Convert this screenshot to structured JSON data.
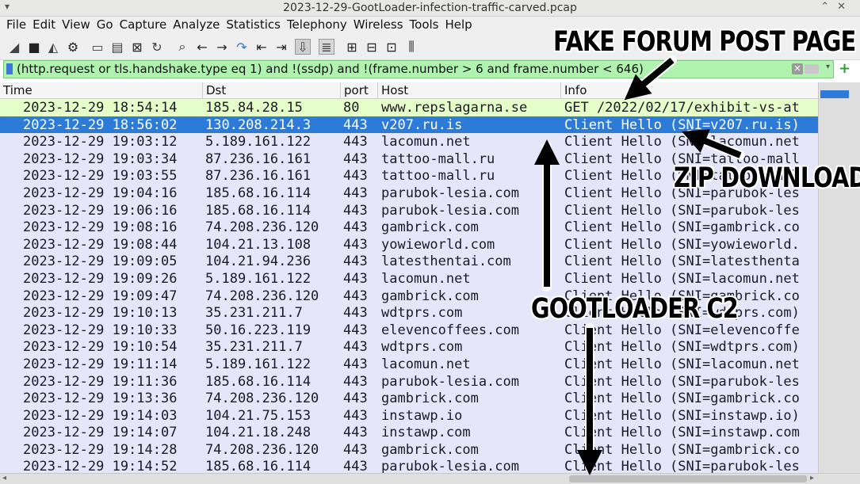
{
  "window": {
    "title": "2023-12-29-GootLoader-infection-traffic-carved.pcap"
  },
  "menu": [
    "File",
    "Edit",
    "View",
    "Go",
    "Capture",
    "Analyze",
    "Statistics",
    "Telephony",
    "Wireless",
    "Tools",
    "Help"
  ],
  "filter": {
    "text": "(http.request or tls.handshake.type eq 1) and !(ssdp) and !(frame.number > 6 and frame.number < 646)"
  },
  "columns": {
    "time": "Time",
    "dst": "Dst",
    "port": "port",
    "host": "Host",
    "info": "Info"
  },
  "rows": [
    {
      "time": "2023-12-29 18:54:14",
      "dst": "185.84.28.15",
      "port": "80",
      "host": "www.repslagarna.se",
      "info": "GET /2022/02/17/exhibit-vs-at"
    },
    {
      "time": "2023-12-29 18:56:02",
      "dst": "130.208.214.3",
      "port": "443",
      "host": "v207.ru.is",
      "info": "Client Hello (SNI=v207.ru.is)"
    },
    {
      "time": "2023-12-29 19:03:12",
      "dst": "5.189.161.122",
      "port": "443",
      "host": "lacomun.net",
      "info": "Client Hello (SNI=lacomun.net"
    },
    {
      "time": "2023-12-29 19:03:34",
      "dst": "87.236.16.161",
      "port": "443",
      "host": "tattoo-mall.ru",
      "info": "Client Hello (SNI=tattoo-mall"
    },
    {
      "time": "2023-12-29 19:03:55",
      "dst": "87.236.16.161",
      "port": "443",
      "host": "tattoo-mall.ru",
      "info": "Client Hello (SNI=tattoo-mall"
    },
    {
      "time": "2023-12-29 19:04:16",
      "dst": "185.68.16.114",
      "port": "443",
      "host": "parubok-lesia.com",
      "info": "Client Hello (SNI=parubok-les"
    },
    {
      "time": "2023-12-29 19:06:16",
      "dst": "185.68.16.114",
      "port": "443",
      "host": "parubok-lesia.com",
      "info": "Client Hello (SNI=parubok-les"
    },
    {
      "time": "2023-12-29 19:08:16",
      "dst": "74.208.236.120",
      "port": "443",
      "host": "gambrick.com",
      "info": "Client Hello (SNI=gambrick.co"
    },
    {
      "time": "2023-12-29 19:08:44",
      "dst": "104.21.13.108",
      "port": "443",
      "host": "yowieworld.com",
      "info": "Client Hello (SNI=yowieworld."
    },
    {
      "time": "2023-12-29 19:09:05",
      "dst": "104.21.94.236",
      "port": "443",
      "host": "latesthentai.com",
      "info": "Client Hello (SNI=latesthenta"
    },
    {
      "time": "2023-12-29 19:09:26",
      "dst": "5.189.161.122",
      "port": "443",
      "host": "lacomun.net",
      "info": "Client Hello (SNI=lacomun.net"
    },
    {
      "time": "2023-12-29 19:09:47",
      "dst": "74.208.236.120",
      "port": "443",
      "host": "gambrick.com",
      "info": "Client Hello (SNI=gambrick.co"
    },
    {
      "time": "2023-12-29 19:10:13",
      "dst": "35.231.211.7",
      "port": "443",
      "host": "wdtprs.com",
      "info": "Client Hello (SNI=wdtprs.com)"
    },
    {
      "time": "2023-12-29 19:10:33",
      "dst": "50.16.223.119",
      "port": "443",
      "host": "elevencoffees.com",
      "info": "Client Hello (SNI=elevencoffe"
    },
    {
      "time": "2023-12-29 19:10:54",
      "dst": "35.231.211.7",
      "port": "443",
      "host": "wdtprs.com",
      "info": "Client Hello (SNI=wdtprs.com)"
    },
    {
      "time": "2023-12-29 19:11:14",
      "dst": "5.189.161.122",
      "port": "443",
      "host": "lacomun.net",
      "info": "Client Hello (SNI=lacomun.net"
    },
    {
      "time": "2023-12-29 19:11:36",
      "dst": "185.68.16.114",
      "port": "443",
      "host": "parubok-lesia.com",
      "info": "Client Hello (SNI=parubok-les"
    },
    {
      "time": "2023-12-29 19:13:36",
      "dst": "74.208.236.120",
      "port": "443",
      "host": "gambrick.com",
      "info": "Client Hello (SNI=gambrick.co"
    },
    {
      "time": "2023-12-29 19:14:03",
      "dst": "104.21.75.153",
      "port": "443",
      "host": "instawp.io",
      "info": "Client Hello (SNI=instawp.io)"
    },
    {
      "time": "2023-12-29 19:14:07",
      "dst": "104.21.18.248",
      "port": "443",
      "host": "instawp.com",
      "info": "Client Hello (SNI=instawp.com"
    },
    {
      "time": "2023-12-29 19:14:28",
      "dst": "74.208.236.120",
      "port": "443",
      "host": "gambrick.com",
      "info": "Client Hello (SNI=gambrick.co"
    },
    {
      "time": "2023-12-29 19:14:52",
      "dst": "185.68.16.114",
      "port": "443",
      "host": "parubok-lesia.com",
      "info": "Client Hello (SNI=parubok-les"
    }
  ],
  "selected_row": 1,
  "annotations": {
    "fake_forum": "FAKE FORUM POST PAGE",
    "zip_download": "ZIP DOWNLOAD",
    "gootloader_c2": "GOOTLOADER C2"
  },
  "colors": {
    "http_row": "#e4ffc7",
    "selected_row": "#2d7bd8",
    "tls_row": "#e6e6fa",
    "filter_bg": "#b0f2b0"
  }
}
